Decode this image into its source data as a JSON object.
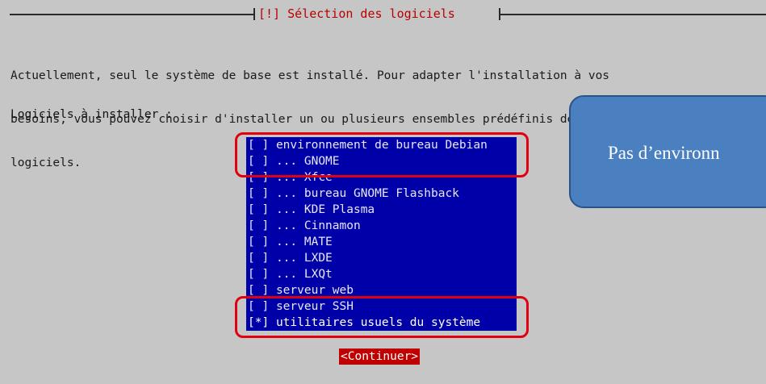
{
  "dialog": {
    "title": "[!] Sélection des logiciels",
    "intro_lines": [
      "Actuellement, seul le système de base est installé. Pour adapter l'installation à vos",
      "besoins, vous pouvez choisir d'installer un ou plusieurs ensembles prédéfinis de",
      "logiciels."
    ],
    "prompt": "Logiciels à installer :",
    "items": [
      {
        "mark": "[ ]",
        "label": "environnement de bureau Debian"
      },
      {
        "mark": "[ ]",
        "label": "... GNOME"
      },
      {
        "mark": "[ ]",
        "label": "... Xfce"
      },
      {
        "mark": "[ ]",
        "label": "... bureau GNOME Flashback"
      },
      {
        "mark": "[ ]",
        "label": "... KDE Plasma"
      },
      {
        "mark": "[ ]",
        "label": "... Cinnamon"
      },
      {
        "mark": "[ ]",
        "label": "... MATE"
      },
      {
        "mark": "[ ]",
        "label": "... LXDE"
      },
      {
        "mark": "[ ]",
        "label": "... LXQt"
      },
      {
        "mark": "[ ]",
        "label": "serveur web"
      },
      {
        "mark": "[ ]",
        "label": "serveur SSH"
      },
      {
        "mark": "[*]",
        "label": "utilitaires usuels du système"
      }
    ],
    "continue_label": "<Continuer>"
  },
  "callout": {
    "text": "Pas d’environn"
  },
  "colors": {
    "background": "#c6c6c6",
    "list_background": "#0000a8",
    "title_red": "#b80000",
    "highlight_red": "#e00010",
    "button_red": "#c00000",
    "callout_blue": "#4a7fc0"
  }
}
